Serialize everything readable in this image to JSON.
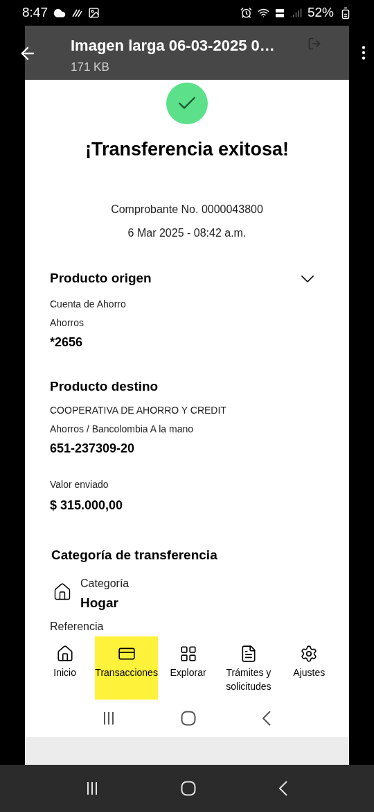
{
  "status_bar": {
    "time": "8:47",
    "battery": "52%"
  },
  "viewer": {
    "title": "Imagen larga 06-03-2025 0…",
    "size": "171 KB"
  },
  "receipt": {
    "heading": "¡Transferencia exitosa!",
    "voucher": "Comprobante No. 0000043800",
    "date": "6 Mar 2025 - 08:42 a.m.",
    "origin": {
      "title": "Producto origen",
      "expanded": false,
      "lines": [
        "Cuenta de Ahorro",
        "Ahorros"
      ],
      "value": "*2656"
    },
    "destination": {
      "title": "Producto destino",
      "lines": [
        "COOPERATIVA DE AHORRO Y CREDIT",
        "Ahorros / Bancolombia A la mano"
      ],
      "value": "651-237309-20"
    },
    "amount": {
      "label": "Valor enviado",
      "value": "$ 315.000,00"
    },
    "category": {
      "title": "Categoría de transferencia",
      "label": "Categoría",
      "value": "Hogar"
    },
    "reference": {
      "label": "Referencia"
    }
  },
  "nav": [
    {
      "kind": "home",
      "label": "Inicio",
      "selected": false
    },
    {
      "kind": "cards",
      "label": "Transacciones",
      "selected": true
    },
    {
      "kind": "grid",
      "label": "Explorar",
      "selected": false
    },
    {
      "kind": "docs",
      "label": "Trámites y solicitudes",
      "selected": false
    },
    {
      "kind": "gear",
      "label": "Ajustes",
      "selected": false
    }
  ]
}
